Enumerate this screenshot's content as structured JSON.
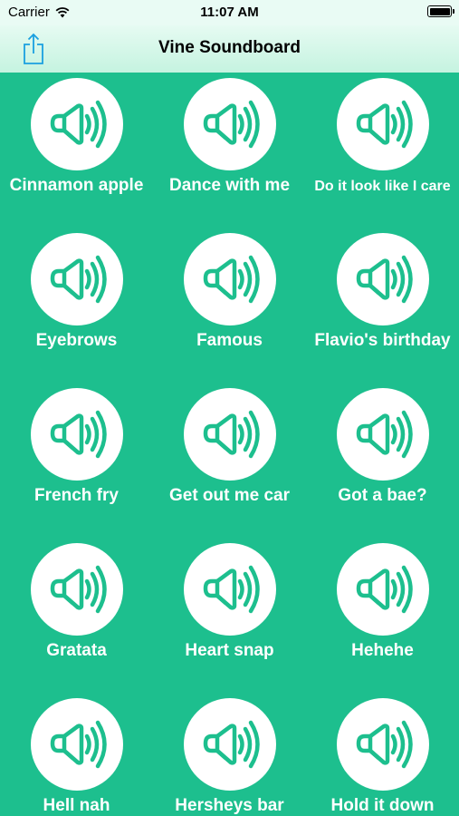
{
  "status_bar": {
    "carrier": "Carrier",
    "time": "11:07 AM"
  },
  "nav": {
    "title": "Vine Soundboard",
    "share_icon": "share-icon"
  },
  "colors": {
    "background": "#1dbf8e",
    "accent": "#1dbf8e",
    "nav_bar": "#d4f7e9"
  },
  "sounds": [
    {
      "label": "Cinnamon apple",
      "icon": "speaker-icon"
    },
    {
      "label": "Dance with me",
      "icon": "speaker-icon"
    },
    {
      "label": "Do it look like I care",
      "icon": "speaker-icon"
    },
    {
      "label": "Eyebrows",
      "icon": "speaker-icon"
    },
    {
      "label": "Famous",
      "icon": "speaker-icon"
    },
    {
      "label": "Flavio's birthday",
      "icon": "speaker-icon"
    },
    {
      "label": "French fry",
      "icon": "speaker-icon"
    },
    {
      "label": "Get out me car",
      "icon": "speaker-icon"
    },
    {
      "label": "Got a bae?",
      "icon": "speaker-icon"
    },
    {
      "label": "Gratata",
      "icon": "speaker-icon"
    },
    {
      "label": "Heart snap",
      "icon": "speaker-icon"
    },
    {
      "label": "Hehehe",
      "icon": "speaker-icon"
    },
    {
      "label": "Hell nah",
      "icon": "speaker-icon"
    },
    {
      "label": "Hersheys bar",
      "icon": "speaker-icon"
    },
    {
      "label": "Hold it down",
      "icon": "speaker-icon"
    }
  ]
}
